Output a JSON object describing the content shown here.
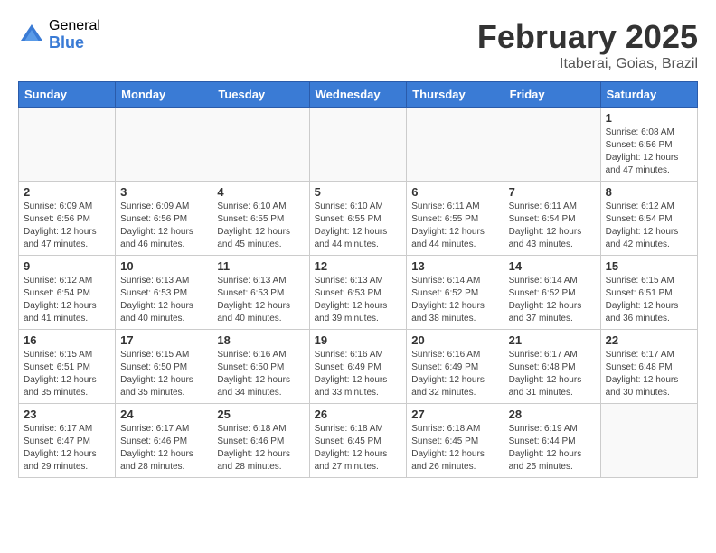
{
  "logo": {
    "general": "General",
    "blue": "Blue"
  },
  "title": "February 2025",
  "subtitle": "Itaberai, Goias, Brazil",
  "days_of_week": [
    "Sunday",
    "Monday",
    "Tuesday",
    "Wednesday",
    "Thursday",
    "Friday",
    "Saturday"
  ],
  "weeks": [
    [
      {
        "day": "",
        "info": ""
      },
      {
        "day": "",
        "info": ""
      },
      {
        "day": "",
        "info": ""
      },
      {
        "day": "",
        "info": ""
      },
      {
        "day": "",
        "info": ""
      },
      {
        "day": "",
        "info": ""
      },
      {
        "day": "1",
        "info": "Sunrise: 6:08 AM\nSunset: 6:56 PM\nDaylight: 12 hours and 47 minutes."
      }
    ],
    [
      {
        "day": "2",
        "info": "Sunrise: 6:09 AM\nSunset: 6:56 PM\nDaylight: 12 hours and 47 minutes."
      },
      {
        "day": "3",
        "info": "Sunrise: 6:09 AM\nSunset: 6:56 PM\nDaylight: 12 hours and 46 minutes."
      },
      {
        "day": "4",
        "info": "Sunrise: 6:10 AM\nSunset: 6:55 PM\nDaylight: 12 hours and 45 minutes."
      },
      {
        "day": "5",
        "info": "Sunrise: 6:10 AM\nSunset: 6:55 PM\nDaylight: 12 hours and 44 minutes."
      },
      {
        "day": "6",
        "info": "Sunrise: 6:11 AM\nSunset: 6:55 PM\nDaylight: 12 hours and 44 minutes."
      },
      {
        "day": "7",
        "info": "Sunrise: 6:11 AM\nSunset: 6:54 PM\nDaylight: 12 hours and 43 minutes."
      },
      {
        "day": "8",
        "info": "Sunrise: 6:12 AM\nSunset: 6:54 PM\nDaylight: 12 hours and 42 minutes."
      }
    ],
    [
      {
        "day": "9",
        "info": "Sunrise: 6:12 AM\nSunset: 6:54 PM\nDaylight: 12 hours and 41 minutes."
      },
      {
        "day": "10",
        "info": "Sunrise: 6:13 AM\nSunset: 6:53 PM\nDaylight: 12 hours and 40 minutes."
      },
      {
        "day": "11",
        "info": "Sunrise: 6:13 AM\nSunset: 6:53 PM\nDaylight: 12 hours and 40 minutes."
      },
      {
        "day": "12",
        "info": "Sunrise: 6:13 AM\nSunset: 6:53 PM\nDaylight: 12 hours and 39 minutes."
      },
      {
        "day": "13",
        "info": "Sunrise: 6:14 AM\nSunset: 6:52 PM\nDaylight: 12 hours and 38 minutes."
      },
      {
        "day": "14",
        "info": "Sunrise: 6:14 AM\nSunset: 6:52 PM\nDaylight: 12 hours and 37 minutes."
      },
      {
        "day": "15",
        "info": "Sunrise: 6:15 AM\nSunset: 6:51 PM\nDaylight: 12 hours and 36 minutes."
      }
    ],
    [
      {
        "day": "16",
        "info": "Sunrise: 6:15 AM\nSunset: 6:51 PM\nDaylight: 12 hours and 35 minutes."
      },
      {
        "day": "17",
        "info": "Sunrise: 6:15 AM\nSunset: 6:50 PM\nDaylight: 12 hours and 35 minutes."
      },
      {
        "day": "18",
        "info": "Sunrise: 6:16 AM\nSunset: 6:50 PM\nDaylight: 12 hours and 34 minutes."
      },
      {
        "day": "19",
        "info": "Sunrise: 6:16 AM\nSunset: 6:49 PM\nDaylight: 12 hours and 33 minutes."
      },
      {
        "day": "20",
        "info": "Sunrise: 6:16 AM\nSunset: 6:49 PM\nDaylight: 12 hours and 32 minutes."
      },
      {
        "day": "21",
        "info": "Sunrise: 6:17 AM\nSunset: 6:48 PM\nDaylight: 12 hours and 31 minutes."
      },
      {
        "day": "22",
        "info": "Sunrise: 6:17 AM\nSunset: 6:48 PM\nDaylight: 12 hours and 30 minutes."
      }
    ],
    [
      {
        "day": "23",
        "info": "Sunrise: 6:17 AM\nSunset: 6:47 PM\nDaylight: 12 hours and 29 minutes."
      },
      {
        "day": "24",
        "info": "Sunrise: 6:17 AM\nSunset: 6:46 PM\nDaylight: 12 hours and 28 minutes."
      },
      {
        "day": "25",
        "info": "Sunrise: 6:18 AM\nSunset: 6:46 PM\nDaylight: 12 hours and 28 minutes."
      },
      {
        "day": "26",
        "info": "Sunrise: 6:18 AM\nSunset: 6:45 PM\nDaylight: 12 hours and 27 minutes."
      },
      {
        "day": "27",
        "info": "Sunrise: 6:18 AM\nSunset: 6:45 PM\nDaylight: 12 hours and 26 minutes."
      },
      {
        "day": "28",
        "info": "Sunrise: 6:19 AM\nSunset: 6:44 PM\nDaylight: 12 hours and 25 minutes."
      },
      {
        "day": "",
        "info": ""
      }
    ]
  ]
}
